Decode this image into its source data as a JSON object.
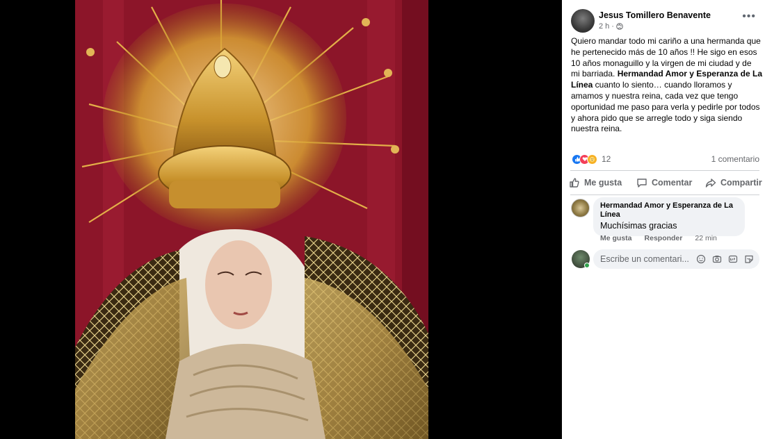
{
  "post": {
    "author": "Jesus Tomillero Benavente",
    "time": "2 h",
    "separator": "·",
    "text_part1": "Quiero mandar todo mi cariño a una hermanda que he pertenecido más de 10 años !! He sigo en esos 10 años monaguillo y la virgen de mi ciudad y de mi barriada. ",
    "text_bold": "Hermandad Amor y Esperanza de La Línea",
    "text_part2": " cuanto lo siento… cuando lloramos y amamos y nuestra reina, cada vez que tengo oportunidad me paso para verla y pedirle por todos y ahora pido que se arregle todo y siga siendo nuestra reina."
  },
  "reactions": {
    "count": "12",
    "comments_count": "1 comentario",
    "icons": [
      "like-icon",
      "love-icon",
      "care-icon"
    ]
  },
  "actions": {
    "like_label": "Me gusta",
    "comment_label": "Comentar",
    "share_label": "Compartir"
  },
  "comment": {
    "author": "Hermandad Amor y Esperanza de La Línea",
    "text": "Muchísimas gracias",
    "like_label": "Me gusta",
    "reply_label": "Responder",
    "time": "22 min"
  },
  "composer": {
    "placeholder": "Escribe un comentari..."
  },
  "colors": {
    "like_blue": "#1877f2",
    "love_red": "#f33e58",
    "care_yellow": "#f7b125",
    "online_green": "#31a24c"
  }
}
